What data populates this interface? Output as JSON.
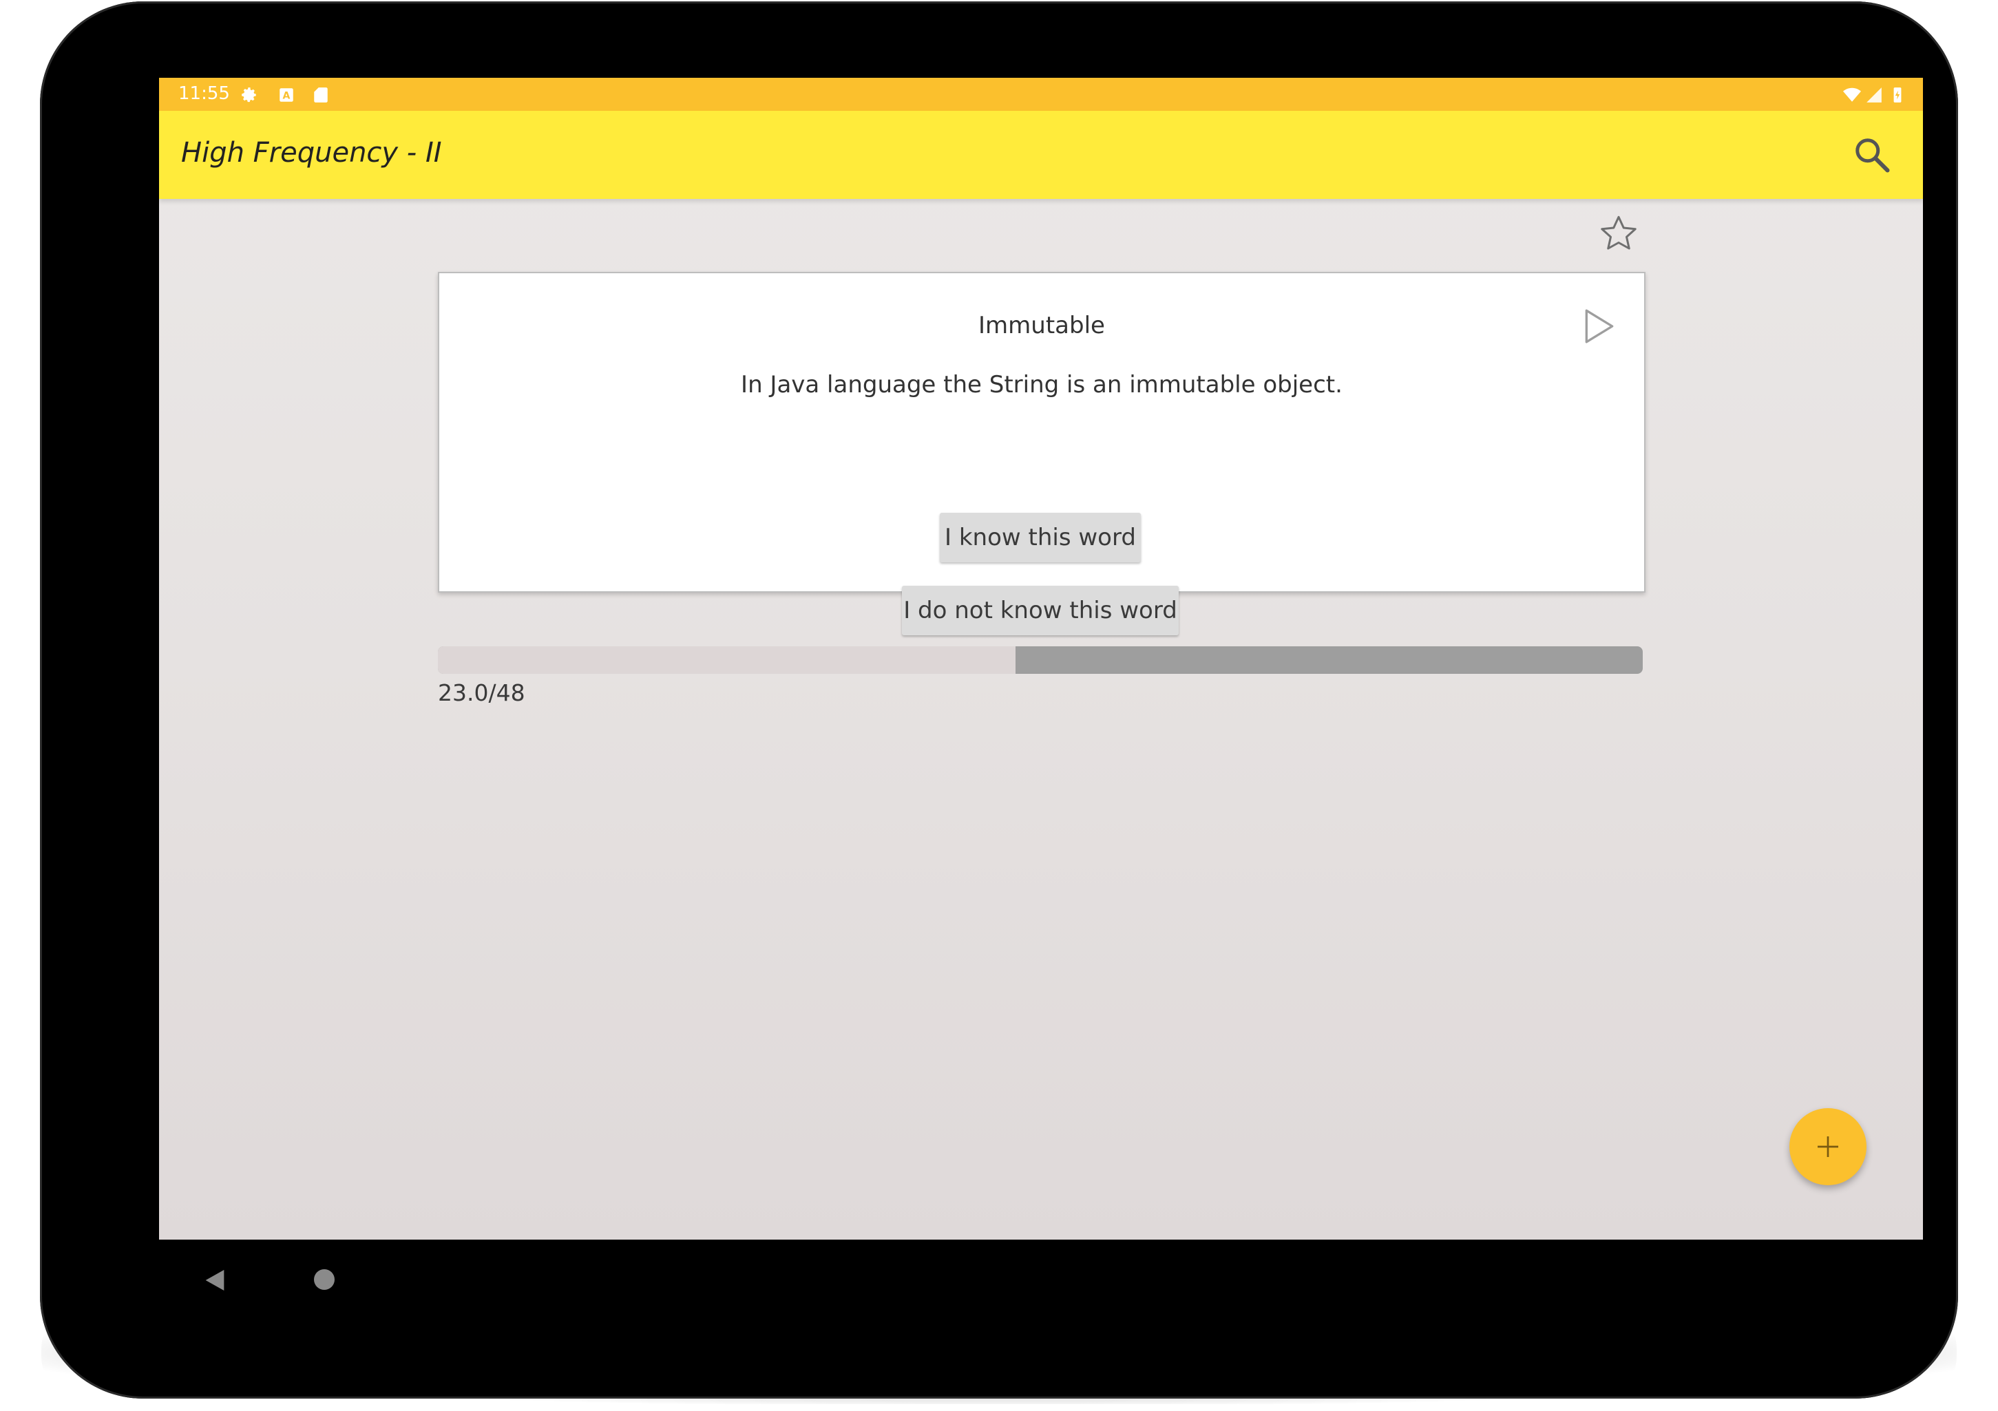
{
  "status_bar": {
    "time": "11:55",
    "left_icons": [
      "settings-icon",
      "a-badge-icon",
      "sd-card-icon"
    ],
    "right_icons": [
      "wifi-icon",
      "signal-icon",
      "battery-icon"
    ]
  },
  "app_bar": {
    "title": "High Frequency - II",
    "actions": [
      "search-icon"
    ]
  },
  "card": {
    "word": "Immutable",
    "example": "In Java language the String is an immutable object.",
    "know_button": "I know this word",
    "dont_know_button": "I do not know this word"
  },
  "progress": {
    "label": "23.0/48",
    "current": 23.0,
    "total": 48
  },
  "fab": {
    "icon": "plus-icon"
  },
  "navigation": {
    "icons": [
      "back-icon",
      "home-icon"
    ]
  },
  "colors": {
    "status_bar": "#fbc02d",
    "app_bar": "#ffeb3b",
    "fab": "#fbc02d",
    "progress_track": "#9e9e9e",
    "progress_fill": "#ddd6d6"
  }
}
